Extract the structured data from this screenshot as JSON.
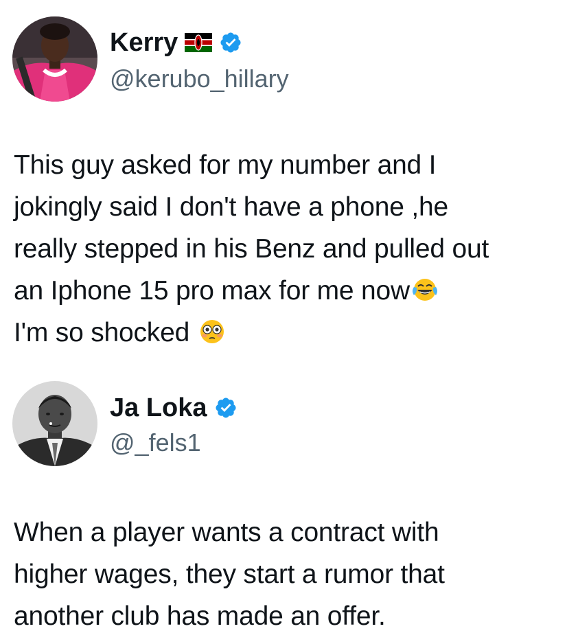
{
  "posts": [
    {
      "author": {
        "name": "Kerry",
        "handle": "@kerubo_hillary",
        "flag_icon": "kenya-flag-icon",
        "verified_icon": "verified-badge-icon",
        "avatar": "profile-photo-woman-pink-shirt"
      },
      "text_lines": [
        "This guy asked for my number and I",
        "jokingly said I don't have a phone ,he",
        "really stepped in his Benz and pulled out",
        "an Iphone 15 pro max for me now",
        "I'm so shocked "
      ],
      "emojis": [
        "face-with-tears-of-joy",
        "flushed-face"
      ]
    },
    {
      "author": {
        "name": "Ja Loka",
        "handle": "@_fels1",
        "verified_icon": "verified-badge-icon",
        "avatar": "profile-photo-man-black-and-white"
      },
      "text_lines": [
        "When a player wants a contract with",
        "higher wages, they start a rumor that",
        "another club has made an offer."
      ]
    }
  ],
  "colors": {
    "text": "#0f1419",
    "handle": "#536471",
    "verified": "#1d9bf0",
    "background": "#ffffff"
  }
}
